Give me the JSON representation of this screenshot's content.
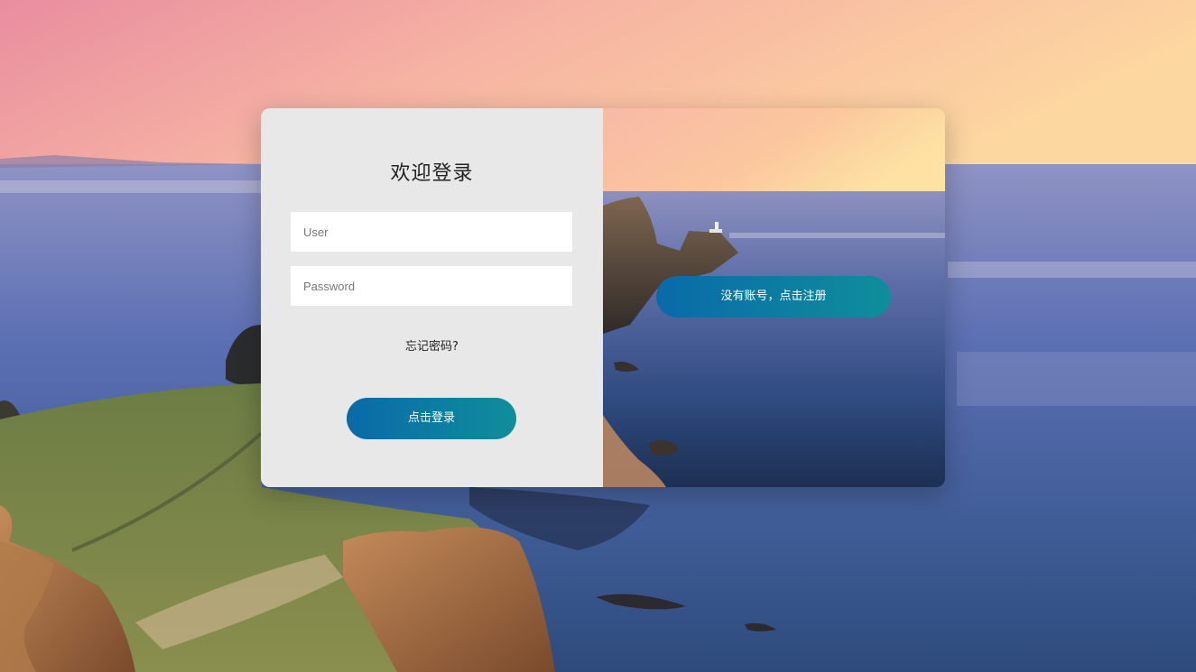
{
  "login": {
    "title": "欢迎登录",
    "user_placeholder": "User",
    "password_placeholder": "Password",
    "forgot_label": "忘记密码?",
    "login_label": "点击登录"
  },
  "register": {
    "label": "没有账号，点击注册"
  },
  "colors": {
    "panel_bg": "#e8e8e8",
    "button_gradient_start": "#0a6aa8",
    "button_gradient_end": "#0f8e9b"
  }
}
